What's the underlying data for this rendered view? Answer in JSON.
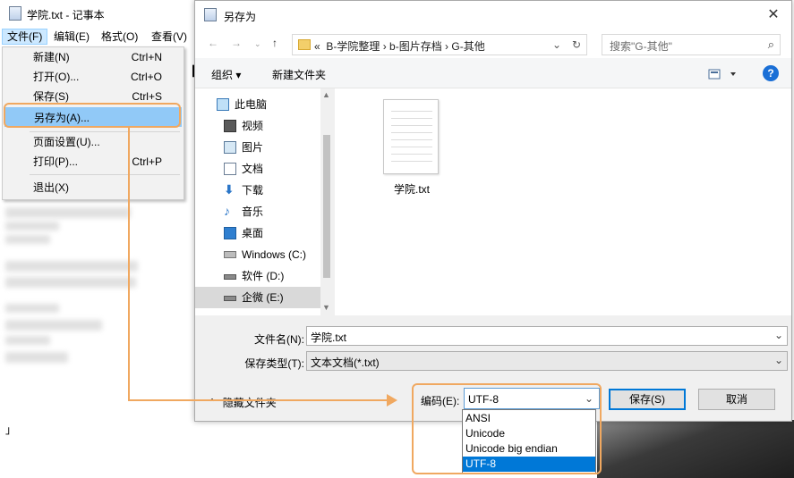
{
  "notepad": {
    "title": "学院.txt - 记事本",
    "menus": [
      "文件(F)",
      "编辑(E)",
      "格式(O)",
      "查看(V)"
    ],
    "file_menu": [
      {
        "label": "新建(N)",
        "shortcut": "Ctrl+N"
      },
      {
        "label": "打开(O)...",
        "shortcut": "Ctrl+O"
      },
      {
        "label": "保存(S)",
        "shortcut": "Ctrl+S"
      },
      {
        "label": "另存为(A)...",
        "shortcut": "",
        "highlighted": true
      },
      {
        "label": "页面设置(U)...",
        "shortcut": ""
      },
      {
        "label": "打印(P)...",
        "shortcut": "Ctrl+P"
      },
      {
        "label": "退出(X)",
        "shortcut": ""
      }
    ],
    "partial_text": "【",
    "cursor_text": "」"
  },
  "dialog": {
    "title": "另存为",
    "close": "✕",
    "address": {
      "prefix": "«",
      "crumbs": "B-学院整理  ›  b-图片存档  ›  G-其他"
    },
    "search_placeholder": "搜索\"G-其他\"",
    "toolbar": {
      "organize": "组织 ▾",
      "new_folder": "新建文件夹",
      "help": "?"
    },
    "nav_items": [
      "此电脑",
      "视频",
      "图片",
      "文档",
      "下载",
      "音乐",
      "桌面",
      "Windows (C:)",
      "软件 (D:)",
      "企微 (E:)"
    ],
    "nav_selected": "企微 (E:)",
    "files": [
      {
        "name": "学院.txt"
      }
    ],
    "filename_label": "文件名(N):",
    "filename_value": "学院.txt",
    "filetype_label": "保存类型(T):",
    "filetype_value": "文本文档(*.txt)",
    "hide_folders": "隐藏文件夹",
    "encoding_label": "编码(E):",
    "encoding_value": "UTF-8",
    "encoding_options": [
      "ANSI",
      "Unicode",
      "Unicode big endian",
      "UTF-8"
    ],
    "encoding_selected": "UTF-8",
    "save": "保存(S)",
    "cancel": "取消"
  },
  "colors": {
    "annotation": "#f0a860",
    "accent": "#0078d7"
  }
}
